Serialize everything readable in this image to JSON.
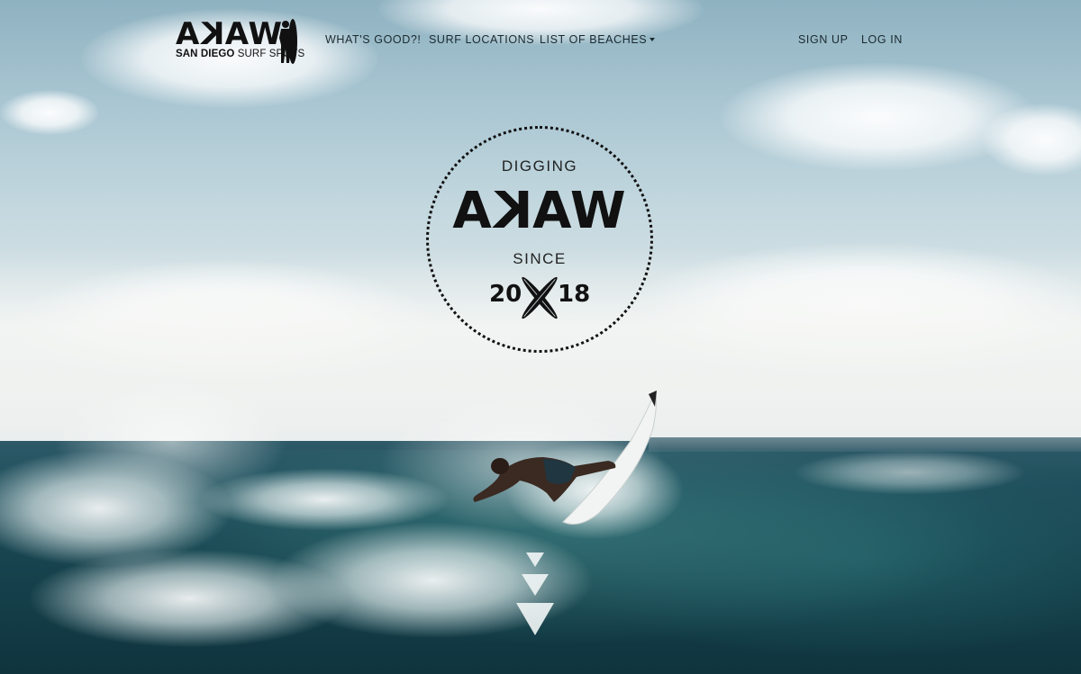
{
  "brand": {
    "word": "AKAW",
    "word_parts": [
      "A",
      "K",
      "AW"
    ],
    "subtitle_bold": "SAN DIEGO",
    "subtitle_rest": " SURF SPOTS",
    "logo_icon": "surfer-with-board-icon"
  },
  "nav": {
    "links": [
      {
        "label": "WHAT'S GOOD?!"
      },
      {
        "label": "SURF LOCATIONS"
      },
      {
        "label": "LIST OF BEACHES",
        "icon": "caret-down-icon"
      }
    ],
    "sign_up": "SIGN UP",
    "log_in": "LOG IN"
  },
  "hero": {
    "top_text": "DIGGING",
    "word_parts": [
      "A",
      "K",
      "AW"
    ],
    "since_text": "SINCE",
    "year_left": "20",
    "year_right": "18",
    "emblem_icon": "crossed-surfboards-icon"
  },
  "scroll": {
    "icon": "scroll-down-arrows-icon"
  },
  "colors": {
    "text_dark": "#111111",
    "nav_text": "#1b2a30",
    "sky_top": "#8fb2c1",
    "sea": "#17444f"
  }
}
